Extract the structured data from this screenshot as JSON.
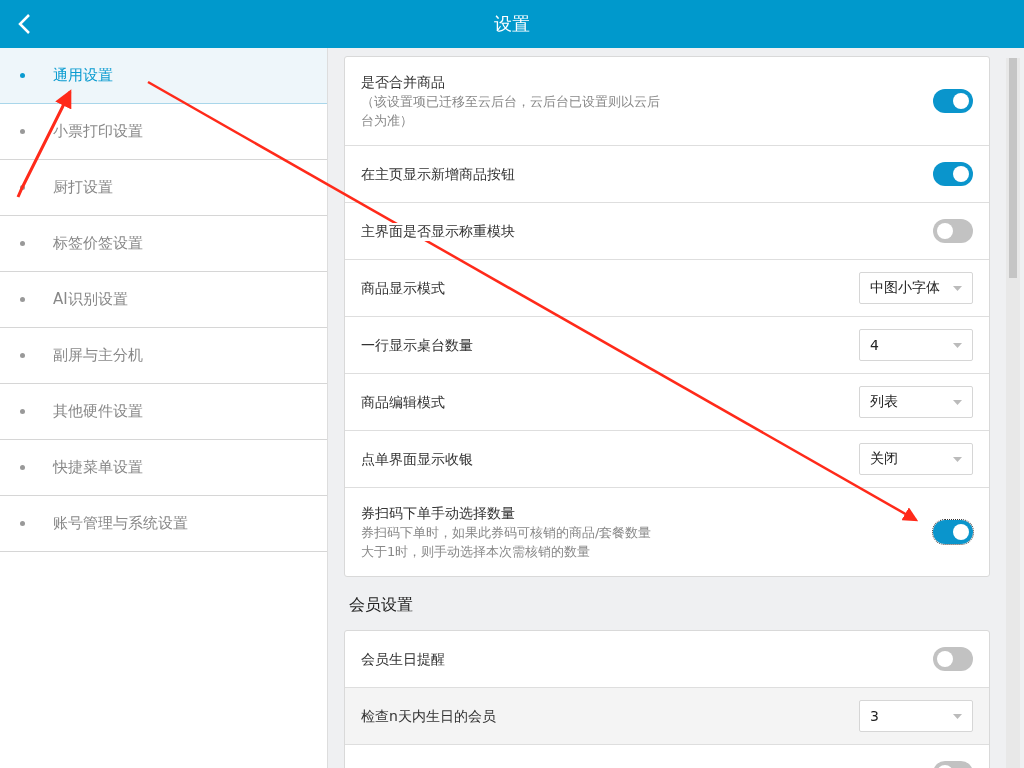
{
  "header": {
    "title": "设置"
  },
  "sidebar": {
    "items": [
      {
        "label": "通用设置",
        "selected": true
      },
      {
        "label": "小票打印设置",
        "selected": false
      },
      {
        "label": "厨打设置",
        "selected": false
      },
      {
        "label": "标签价签设置",
        "selected": false
      },
      {
        "label": "AI识别设置",
        "selected": false
      },
      {
        "label": "副屏与主分机",
        "selected": false
      },
      {
        "label": "其他硬件设置",
        "selected": false
      },
      {
        "label": "快捷菜单设置",
        "selected": false
      },
      {
        "label": "账号管理与系统设置",
        "selected": false
      }
    ]
  },
  "sections": [
    {
      "rows": [
        {
          "kind": "toggle",
          "label": "是否合并商品",
          "hint": "（该设置项已迁移至云后台，云后台已设置则以云后台为准）",
          "on": true
        },
        {
          "kind": "toggle",
          "label": "在主页显示新增商品按钮",
          "on": true
        },
        {
          "kind": "toggle",
          "label": "主界面是否显示称重模块",
          "on": false
        },
        {
          "kind": "select",
          "label": "商品显示模式",
          "value": "中图小字体"
        },
        {
          "kind": "select",
          "label": "一行显示桌台数量",
          "value": "4"
        },
        {
          "kind": "select",
          "label": "商品编辑模式",
          "value": "列表"
        },
        {
          "kind": "select",
          "label": "点单界面显示收银",
          "value": "关闭"
        },
        {
          "kind": "toggle",
          "label": "券扫码下单手动选择数量",
          "hint": "券扫码下单时，如果此券码可核销的商品/套餐数量大于1时，则手动选择本次需核销的数量",
          "on": true,
          "focused": true
        }
      ]
    },
    {
      "title": "会员设置",
      "rows": [
        {
          "kind": "toggle",
          "label": "会员生日提醒",
          "on": false
        },
        {
          "kind": "select",
          "label": "检查n天内生日的会员",
          "value": "3",
          "highlighted": true
        },
        {
          "kind": "toggle",
          "on": false
        }
      ]
    }
  ]
}
